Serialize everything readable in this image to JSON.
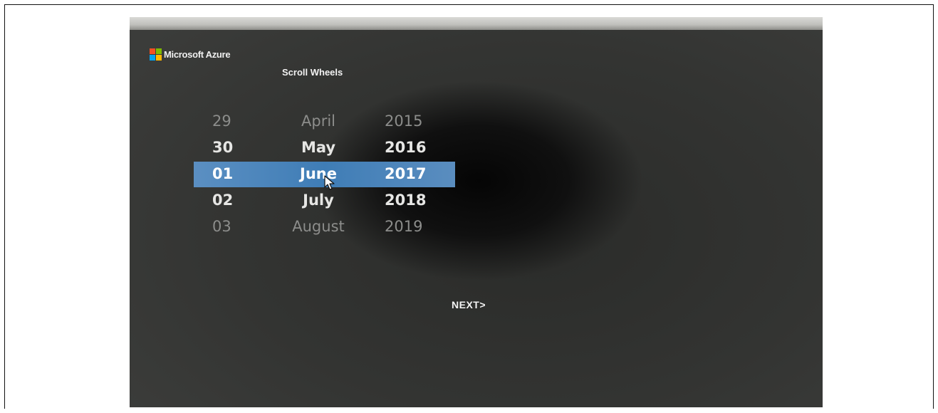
{
  "app": {
    "brand": "Microsoft Azure",
    "title": "Scroll Wheels"
  },
  "wheels": {
    "day": {
      "items": [
        "29",
        "30",
        "01",
        "02",
        "03"
      ],
      "selected": "01"
    },
    "month": {
      "items": [
        "April",
        "May",
        "June",
        "July",
        "August"
      ],
      "selected": "June"
    },
    "year": {
      "items": [
        "2015",
        "2016",
        "2017",
        "2018",
        "2019"
      ],
      "selected": "2017"
    }
  },
  "actions": {
    "next_label": "NEXT>"
  },
  "colors": {
    "selection_bar": "#3f7db6",
    "screen_background": "#343533",
    "text_primary": "#ffffff",
    "text_faded": "#8c8d8b"
  },
  "icons": {
    "logo": "microsoft-logo-icon",
    "pointer": "mouse-cursor-icon"
  }
}
